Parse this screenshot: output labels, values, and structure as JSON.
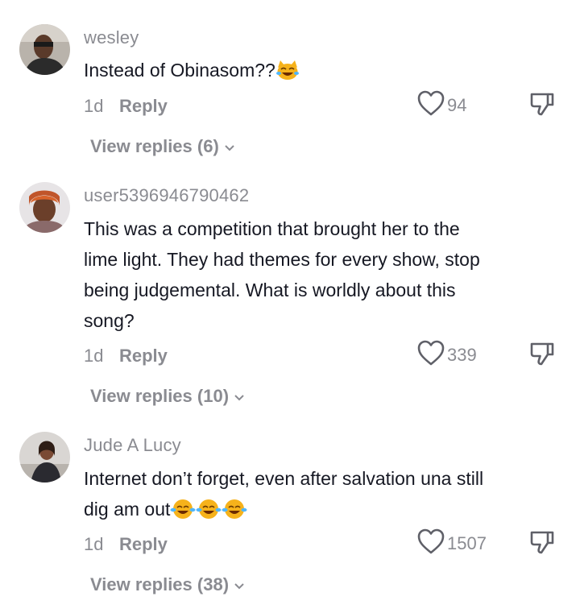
{
  "comments": [
    {
      "username": "wesley",
      "text": "Instead of Obinasom??",
      "emojis": [
        "cat-laughing-icon"
      ],
      "time": "1d",
      "reply_label": "Reply",
      "likes": "94",
      "view_replies": "View replies (6)"
    },
    {
      "username": "user5396946790462",
      "text": "This was a competition that brought her to the lime light. They had themes for every show, stop being judgemental. What is worldly about this song?",
      "emojis": [],
      "time": "1d",
      "reply_label": "Reply",
      "likes": "339",
      "view_replies": "View replies (10)"
    },
    {
      "username": "Jude A Lucy",
      "text": "Internet don’t forget, even after salvation una still dig am out",
      "emojis": [
        "tears-of-joy-icon",
        "tears-of-joy-icon",
        "tears-of-joy-icon"
      ],
      "time": "1d",
      "reply_label": "Reply",
      "likes": "1507",
      "view_replies": "View replies (38)"
    }
  ],
  "colors": {
    "primary_text": "#161823",
    "secondary_text": "#8a8b91",
    "icon": "#5f6068"
  }
}
